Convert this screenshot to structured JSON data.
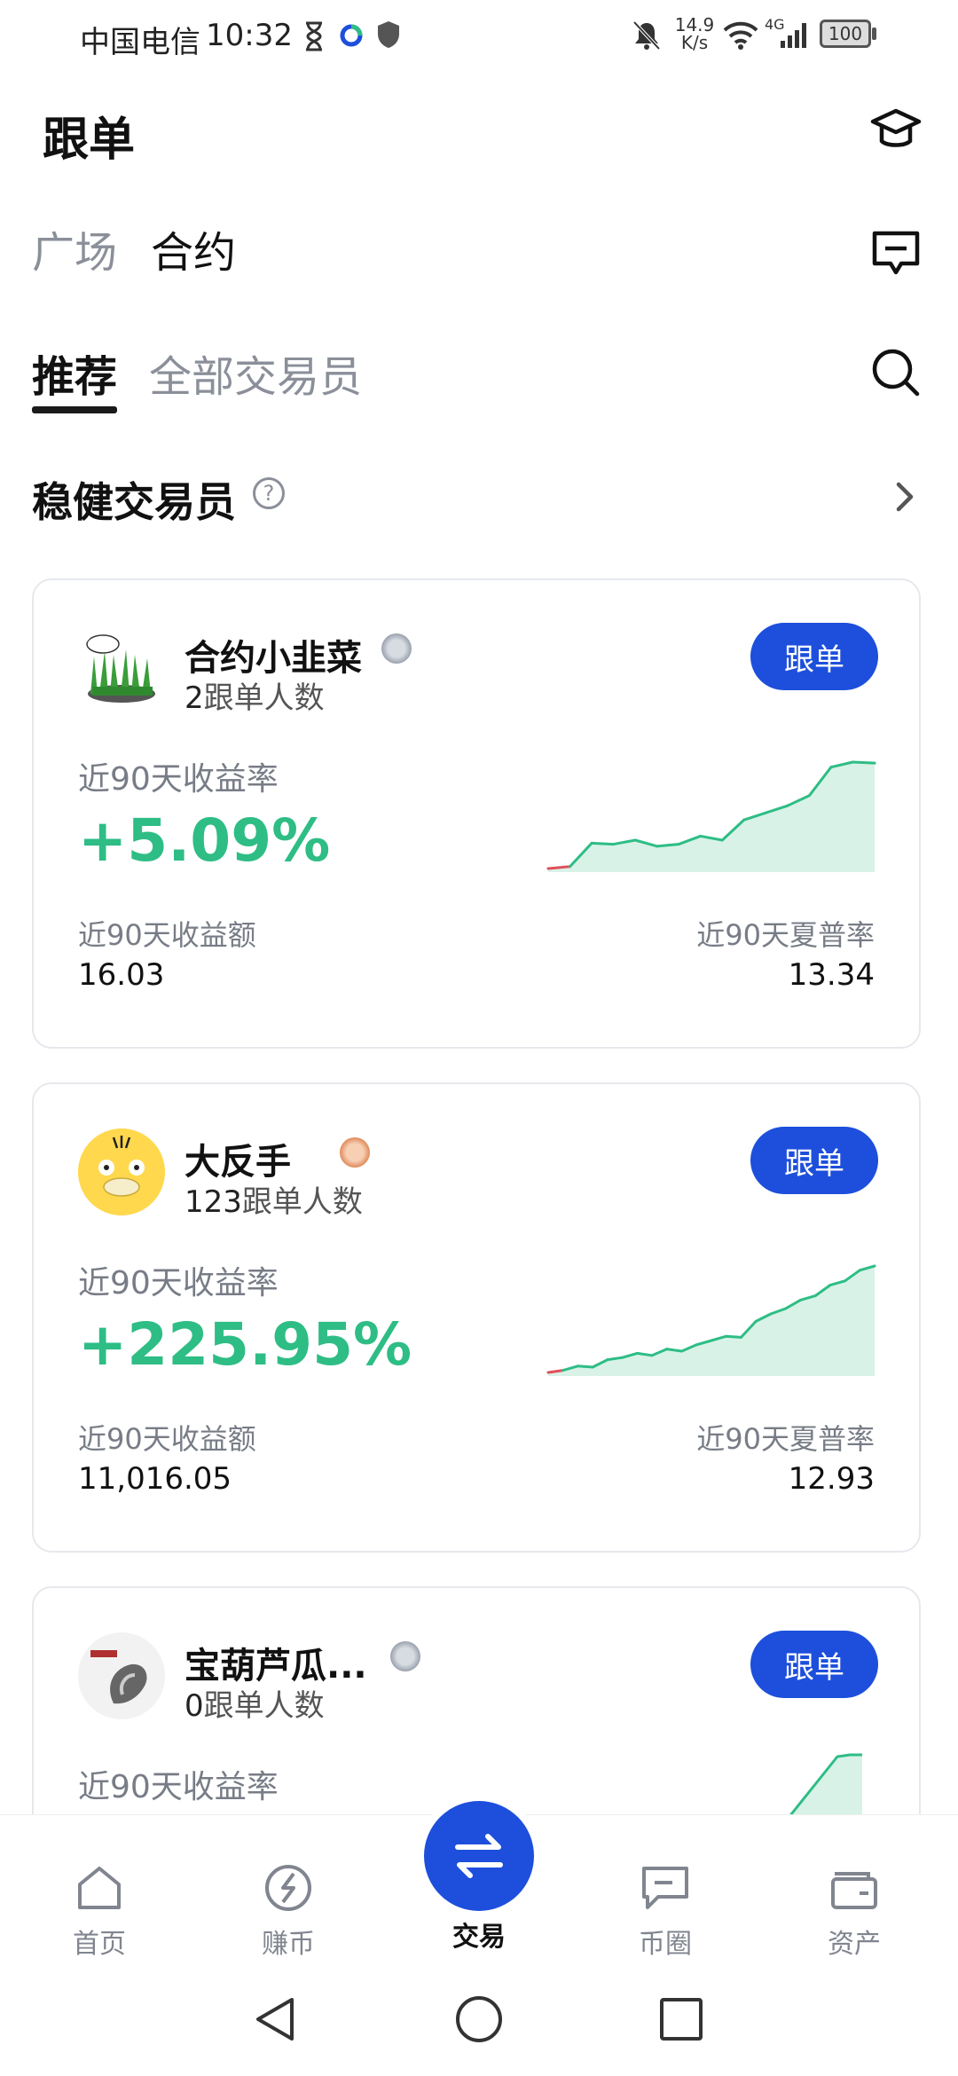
{
  "status_bar": {
    "carrier": "中国电信",
    "time": "10:32",
    "net_speed_top": "14.9",
    "net_speed_bottom": "K/s",
    "network_type": "4G",
    "battery": "100"
  },
  "header": {
    "title": "跟单",
    "icons": [
      "graduation-cap-icon",
      "message-icon",
      "search-icon"
    ]
  },
  "tabs_primary": [
    {
      "label": "广场",
      "active": false
    },
    {
      "label": "合约",
      "active": true
    }
  ],
  "tabs_secondary": [
    {
      "label": "推荐",
      "active": true
    },
    {
      "label": "全部交易员",
      "active": false
    }
  ],
  "section": {
    "title": "稳健交易员",
    "help_glyph": "?"
  },
  "traders": [
    {
      "name": "合约小韭菜",
      "medal": "silver",
      "followers": "2",
      "followers_suffix": "跟单人数",
      "follow_label": "跟单",
      "roi_label": "近90天收益率",
      "roi_value": "+5.09%",
      "amount_label": "近90天收益额",
      "amount_value": "16.03",
      "sharpe_label": "近90天夏普率",
      "sharpe_value": "13.34",
      "spark": [
        0.0,
        0.02,
        0.25,
        0.24,
        0.28,
        0.22,
        0.24,
        0.32,
        0.28,
        0.48,
        0.55,
        0.62,
        0.72,
        1.0,
        1.05,
        1.04
      ]
    },
    {
      "name": "大反手",
      "medal": "bronze",
      "followers": "123",
      "followers_suffix": "跟单人数",
      "follow_label": "跟单",
      "roi_label": "近90天收益率",
      "roi_value": "+225.95%",
      "amount_label": "近90天收益额",
      "amount_value": "11,016.05",
      "sharpe_label": "近90天夏普率",
      "sharpe_value": "12.93",
      "spark": [
        0.0,
        0.02,
        0.06,
        0.05,
        0.12,
        0.14,
        0.18,
        0.16,
        0.22,
        0.2,
        0.26,
        0.3,
        0.34,
        0.33,
        0.48,
        0.55,
        0.6,
        0.68,
        0.72,
        0.82,
        0.86,
        0.96,
        1.0
      ]
    },
    {
      "name": "宝葫芦瓜...",
      "medal": "silver",
      "followers": "0",
      "followers_suffix": "跟单人数",
      "follow_label": "跟单",
      "roi_label": "近90天收益率"
    }
  ],
  "bottom_nav": [
    {
      "label": "首页",
      "icon": "home-icon"
    },
    {
      "label": "赚币",
      "icon": "earn-icon"
    },
    {
      "label": "交易",
      "icon": "swap-arrows-icon",
      "active": true
    },
    {
      "label": "币圈",
      "icon": "community-icon"
    },
    {
      "label": "资产",
      "icon": "wallet-icon"
    }
  ],
  "colors": {
    "accent": "#1d4fdc",
    "positive": "#2ebd85",
    "muted": "#8a8f99"
  }
}
